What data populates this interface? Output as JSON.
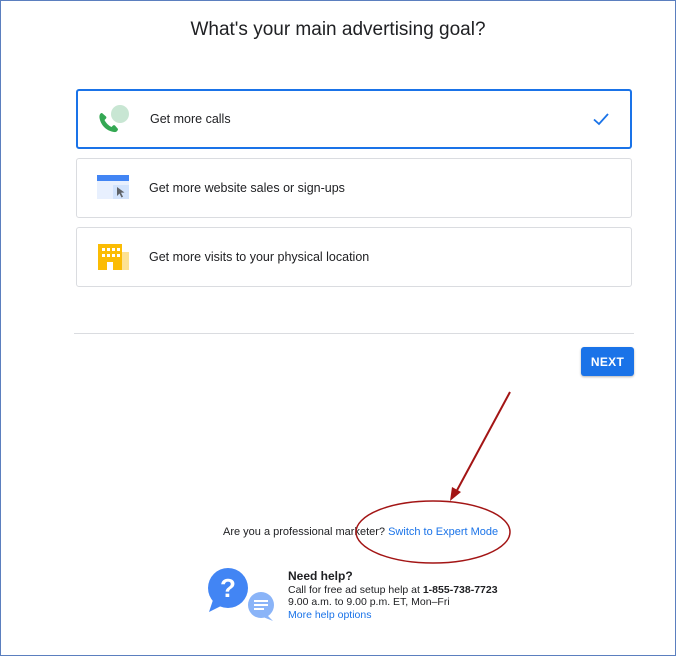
{
  "heading": "What's your main advertising goal?",
  "goals": [
    {
      "label": "Get more calls",
      "icon": "phone-chat-icon",
      "selected": true
    },
    {
      "label": "Get more website sales or sign-ups",
      "icon": "browser-cursor-icon",
      "selected": false
    },
    {
      "label": "Get more visits to your physical location",
      "icon": "storefront-icon",
      "selected": false
    }
  ],
  "selected_check_icon": "checkmark-icon",
  "next_label": "NEXT",
  "pro_prompt": "Are you a professional marketer?",
  "expert_mode_link": "Switch to Expert Mode",
  "help": {
    "title": "Need help?",
    "call_text": "Call for free ad setup help at",
    "phone": "1-855-738-7723",
    "hours": "9.00 a.m. to 9.00 p.m. ET, Mon–Fri",
    "more_options": "More help options"
  },
  "colors": {
    "accent": "#1a73e8",
    "annotation": "#a31515",
    "phone_green": "#34a853",
    "store_yellow": "#fbbc04"
  }
}
